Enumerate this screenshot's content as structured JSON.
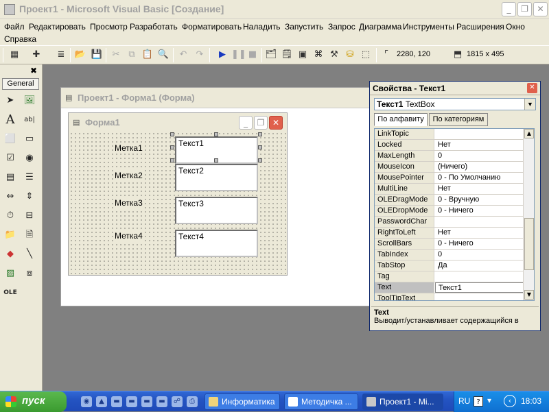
{
  "window": {
    "title": "Проект1 - Microsoft Visual Basic [Создание]",
    "min_glyph": "_",
    "max_glyph": "❐",
    "close_glyph": "✕"
  },
  "menu": [
    "Файл",
    "Редактировать",
    "Просмотр",
    "Разработать",
    "Форматировать",
    "Наладить",
    "Запустить",
    "Запрос",
    "Диаграмма",
    "Инструменты",
    "Расширения",
    "Окно",
    "Справка"
  ],
  "toolbar": {
    "position_readout": "2280, 120",
    "size_readout": "1815 x 495",
    "icons": [
      "add-project-icon",
      "add-form-icon",
      "menu-editor-icon",
      "open-icon",
      "save-icon",
      "cut-icon",
      "copy-icon",
      "paste-icon",
      "find-icon",
      "undo-icon",
      "redo-icon",
      "run-icon",
      "pause-icon",
      "stop-icon",
      "project-explorer-icon",
      "properties-icon",
      "form-layout-icon",
      "object-browser-icon",
      "toolbox-icon",
      "data-view-icon",
      "component-manager-icon"
    ]
  },
  "toolbox": {
    "tab_label": "General",
    "close_glyph": "✖"
  },
  "project_window": {
    "title": "Проект1 - Форма1 (Форма)"
  },
  "form": {
    "title": "Форма1",
    "labels": [
      "Метка1",
      "Метка2",
      "Метка3",
      "Метка4"
    ],
    "textboxes": [
      "Текст1",
      "Текст2",
      "Текст3",
      "Текст4"
    ]
  },
  "properties": {
    "title": "Свойства - Текст1",
    "object_name": "Текст1",
    "object_type": "TextBox",
    "tabs": [
      "По алфавиту",
      "По категориям"
    ],
    "rows": [
      {
        "name": "LinkTopic",
        "value": ""
      },
      {
        "name": "Locked",
        "value": "Нет"
      },
      {
        "name": "MaxLength",
        "value": "0"
      },
      {
        "name": "MouseIcon",
        "value": "(Ничего)"
      },
      {
        "name": "MousePointer",
        "value": "0 - По Умолчанию"
      },
      {
        "name": "MultiLine",
        "value": "Нет"
      },
      {
        "name": "OLEDragMode",
        "value": "0 - Вручную"
      },
      {
        "name": "OLEDropMode",
        "value": "0 - Ничего"
      },
      {
        "name": "PasswordChar",
        "value": ""
      },
      {
        "name": "RightToLeft",
        "value": "Нет"
      },
      {
        "name": "ScrollBars",
        "value": "0 - Ничего"
      },
      {
        "name": "TabIndex",
        "value": "0"
      },
      {
        "name": "TabStop",
        "value": "Да"
      },
      {
        "name": "Tag",
        "value": ""
      },
      {
        "name": "Text",
        "value": "Текст1"
      },
      {
        "name": "ToolTipText",
        "value": ""
      }
    ],
    "description_title": "Text",
    "description_text": "Выводит/устанавливает содержащийся в"
  },
  "taskbar": {
    "start_label": "пуск",
    "tasks": [
      "Информатика",
      "Методичка ...",
      "Проект1 - Mi..."
    ],
    "lang": "RU",
    "clock": "18:03"
  }
}
